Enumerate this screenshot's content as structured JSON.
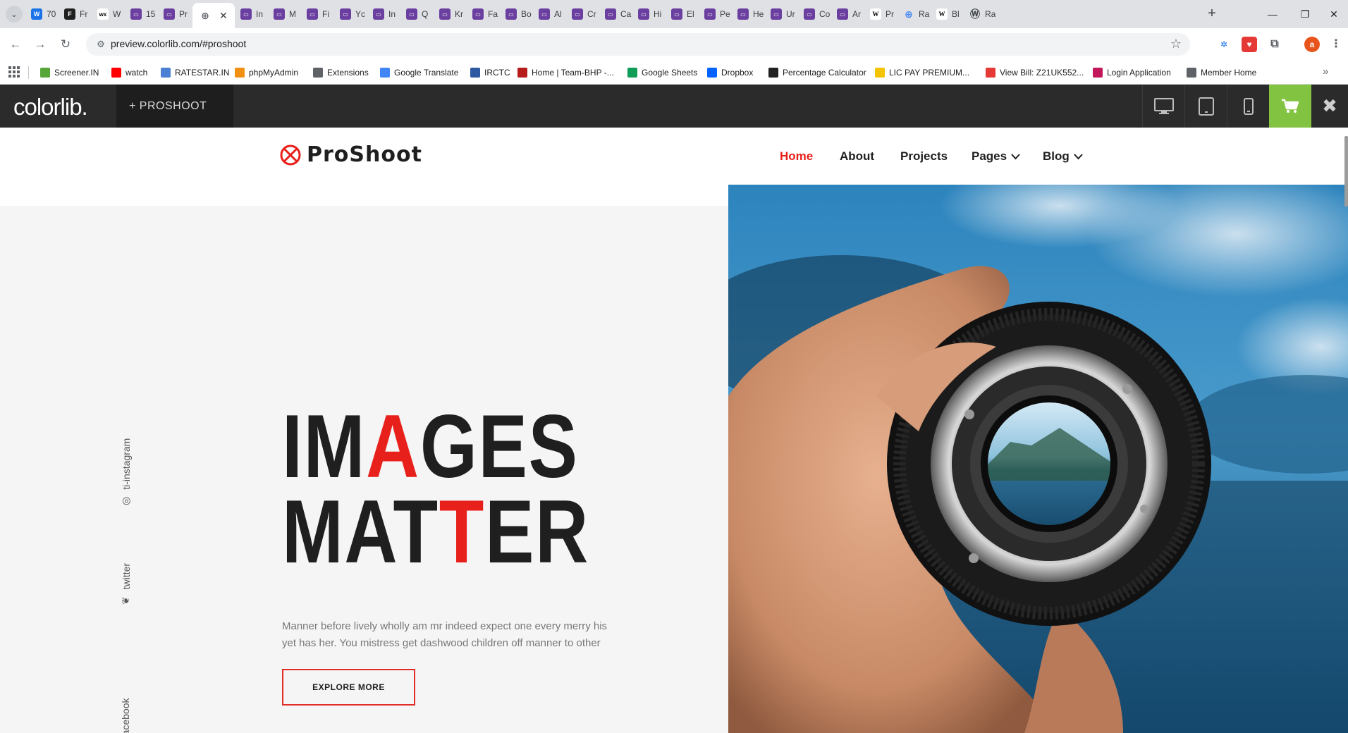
{
  "browser": {
    "tabs": [
      {
        "title": "70",
        "icon": "w-icon",
        "color": "#1a73e8"
      },
      {
        "title": "Fr",
        "icon": "framer-icon",
        "color": "#1f1f1f"
      },
      {
        "title": "W",
        "icon": "wix-icon",
        "color": "#ffffff"
      },
      {
        "title": "15",
        "icon": "colorlib-icon",
        "color": "#6b3fa0"
      },
      {
        "title": "Pr",
        "icon": "colorlib-icon",
        "color": "#6b3fa0"
      },
      {
        "title": "",
        "icon": "globe-icon",
        "color": "#5f6368",
        "active": true
      },
      {
        "title": "In",
        "icon": "colorlib-icon",
        "color": "#6b3fa0"
      },
      {
        "title": "M",
        "icon": "colorlib-icon",
        "color": "#6b3fa0"
      },
      {
        "title": "Fi",
        "icon": "colorlib-icon",
        "color": "#6b3fa0"
      },
      {
        "title": "Yc",
        "icon": "colorlib-icon",
        "color": "#6b3fa0"
      },
      {
        "title": "In",
        "icon": "colorlib-icon",
        "color": "#6b3fa0"
      },
      {
        "title": "Q",
        "icon": "colorlib-icon",
        "color": "#6b3fa0"
      },
      {
        "title": "Kr",
        "icon": "colorlib-icon",
        "color": "#6b3fa0"
      },
      {
        "title": "Fa",
        "icon": "colorlib-icon",
        "color": "#6b3fa0"
      },
      {
        "title": "Bo",
        "icon": "colorlib-icon",
        "color": "#6b3fa0"
      },
      {
        "title": "Al",
        "icon": "colorlib-icon",
        "color": "#6b3fa0"
      },
      {
        "title": "Cr",
        "icon": "colorlib-icon",
        "color": "#6b3fa0"
      },
      {
        "title": "Ca",
        "icon": "colorlib-icon",
        "color": "#6b3fa0"
      },
      {
        "title": "Hi",
        "icon": "colorlib-icon",
        "color": "#6b3fa0"
      },
      {
        "title": "El",
        "icon": "colorlib-icon",
        "color": "#6b3fa0"
      },
      {
        "title": "Pe",
        "icon": "colorlib-icon",
        "color": "#6b3fa0"
      },
      {
        "title": "He",
        "icon": "colorlib-icon",
        "color": "#6b3fa0"
      },
      {
        "title": "Ur",
        "icon": "colorlib-icon",
        "color": "#6b3fa0"
      },
      {
        "title": "Co",
        "icon": "colorlib-icon",
        "color": "#6b3fa0"
      },
      {
        "title": "Ar",
        "icon": "colorlib-icon",
        "color": "#6b3fa0"
      },
      {
        "title": "Pr",
        "icon": "wikipedia-icon",
        "color": "#ffffff"
      },
      {
        "title": "Ra",
        "icon": "globe-icon",
        "color": "#4285f4"
      },
      {
        "title": "Bl",
        "icon": "wikipedia-icon",
        "color": "#ffffff"
      },
      {
        "title": "Ra",
        "icon": "wordpress-icon",
        "color": "#3c4043"
      }
    ],
    "url": "preview.colorlib.com/#proshoot",
    "profile_initial": "a",
    "bookmarks": [
      {
        "label": "Screener.IN",
        "icon": "bar-chart-icon",
        "color": "#57a639"
      },
      {
        "label": "watch",
        "icon": "youtube-icon",
        "color": "#ff0000"
      },
      {
        "label": "RATESTAR.IN",
        "icon": "ratestar-icon",
        "color": "#4a7fd4"
      },
      {
        "label": "phpMyAdmin",
        "icon": "phpmyadmin-icon",
        "color": "#f29111"
      },
      {
        "label": "Extensions",
        "icon": "puzzle-icon",
        "color": "#5f6368"
      },
      {
        "label": "Google Translate",
        "icon": "translate-icon",
        "color": "#4285f4"
      },
      {
        "label": "IRCTC",
        "icon": "irctc-icon",
        "color": "#2d5aa0"
      },
      {
        "label": "Home | Team-BHP -...",
        "icon": "teambhp-icon",
        "color": "#b71c1c"
      },
      {
        "label": "Google Sheets",
        "icon": "sheets-icon",
        "color": "#0f9d58"
      },
      {
        "label": "Dropbox",
        "icon": "dropbox-icon",
        "color": "#0061fe"
      },
      {
        "label": "Percentage Calculator",
        "icon": "percent-icon",
        "color": "#222222"
      },
      {
        "label": "LIC PAY PREMIUM...",
        "icon": "lic-icon",
        "color": "#f5c400"
      },
      {
        "label": "View Bill: Z21UK552...",
        "icon": "bill-icon",
        "color": "#e53935"
      },
      {
        "label": "Login Application",
        "icon": "login-icon",
        "color": "#c2185b"
      },
      {
        "label": "Member Home",
        "icon": "member-icon",
        "color": "#5f6368"
      }
    ]
  },
  "colorlib_bar": {
    "logo": "colorlib.",
    "theme_label": "+  PROSHOOT",
    "accent_color": "#82c341"
  },
  "site": {
    "brand": "ProShoot",
    "accent_color": "#e8201c",
    "nav": [
      {
        "label": "Home",
        "active": true,
        "dropdown": false
      },
      {
        "label": "About",
        "active": false,
        "dropdown": false
      },
      {
        "label": "Projects",
        "active": false,
        "dropdown": false
      },
      {
        "label": "Pages",
        "active": false,
        "dropdown": true
      },
      {
        "label": "Blog",
        "active": false,
        "dropdown": true
      }
    ],
    "social": [
      {
        "label": "ti-instagram",
        "icon": "instagram-icon"
      },
      {
        "label": "twitter",
        "icon": "twitter-icon"
      },
      {
        "label": "facebook",
        "icon": "facebook-icon"
      }
    ],
    "headline": {
      "line1": {
        "before": "IM",
        "red": "A",
        "after": "GES"
      },
      "line2": {
        "before": "MAT",
        "red": "T",
        "after": "ER"
      }
    },
    "lede": "Manner before lively wholly am mr indeed expect one every merry his yet has her. You mistress get dashwood children off manner to other",
    "cta": "EXPLORE MORE"
  }
}
